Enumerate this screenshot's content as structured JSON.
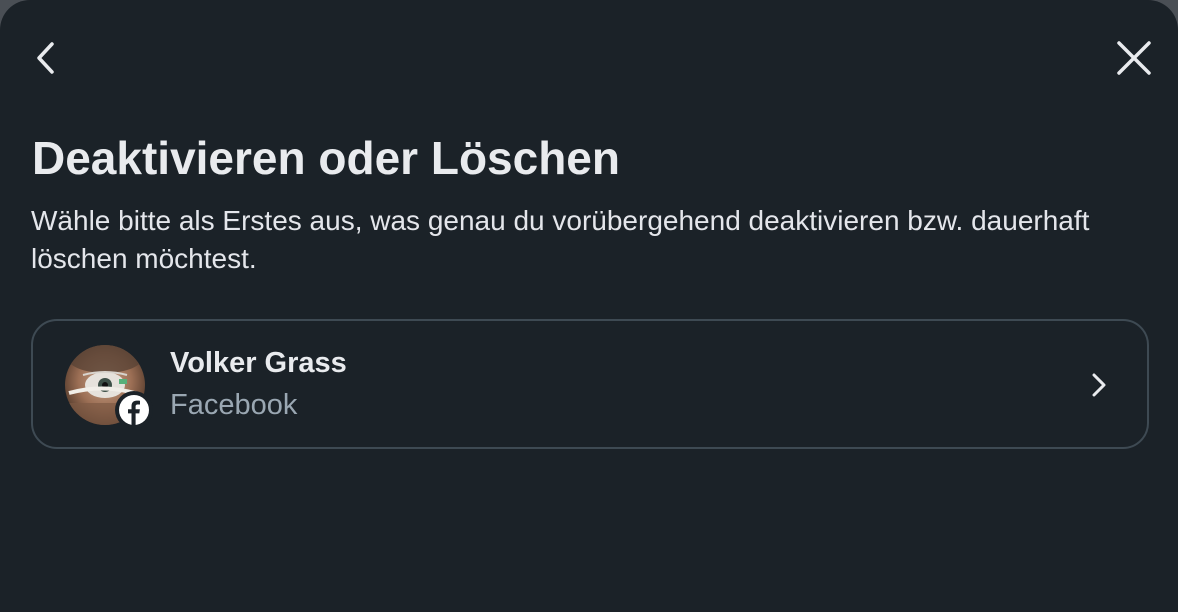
{
  "dialog": {
    "title": "Deaktivieren oder Löschen",
    "description": "Wähle bitte als Erstes aus, was genau du vorübergehend deaktivieren bzw. dauerhaft löschen möchtest.",
    "back_icon": "chevron-left-icon",
    "close_icon": "close-icon"
  },
  "accounts": [
    {
      "name": "Volker Grass",
      "platform": "Facebook",
      "avatar_icon": "avatar-photo",
      "badge_icon": "facebook-icon",
      "action_icon": "chevron-right-icon"
    }
  ],
  "colors": {
    "background": "#1b2228",
    "text_primary": "#e9ebee",
    "text_secondary": "#9aa7b2",
    "card_border": "#3e4a53"
  }
}
